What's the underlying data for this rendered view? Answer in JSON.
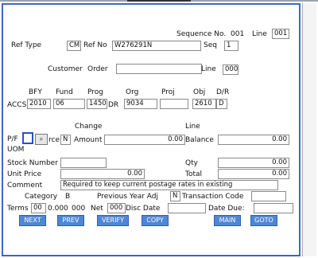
{
  "header": {
    "seq_label": "Sequence No.",
    "seq_value": "001",
    "line_label": "Line",
    "line_value": "001"
  },
  "ref": {
    "type_label": "Ref Type",
    "type_value": "CM",
    "no_label": "Ref No",
    "no_value": "W276291N",
    "seq_label": "Seq",
    "seq_value": "1"
  },
  "customer": {
    "label": "Customer",
    "order_label": "Order",
    "order_value": "",
    "line_label": "Line",
    "line_value": "000"
  },
  "accs": {
    "row_label": "ACCS",
    "bfy_label": "BFY",
    "bfy_value": "2010",
    "fund_label": "Fund",
    "fund_value": "06",
    "prog_label": "Prog",
    "prog_value": "1450",
    "prog_suffix": "DR",
    "org_label": "Org",
    "org_value": "9034",
    "proj_label": "Proj",
    "proj_value": "",
    "obj_label": "Obj",
    "obj_value": "2610",
    "dr_label": "D/R",
    "dr_value": "D"
  },
  "amounts": {
    "pf_label": "P/F",
    "pf_value": "",
    "pf_tail": "rce",
    "pf_flag": "N",
    "uom_label": "UOM",
    "change_label": "Change",
    "amount_label": "Amount",
    "amount_value": "0.00",
    "line_label": "Line",
    "balance_label": "Balance",
    "balance_value": "0.00"
  },
  "stock": {
    "label": "Stock Number",
    "value": "",
    "qty_label": "Qty",
    "qty_value": "0.00"
  },
  "price": {
    "label": "Unit Price",
    "value": "0.00",
    "total_label": "Total",
    "total_value": "0.00"
  },
  "comment": {
    "label": "Comment",
    "value": "Required to keep current postage rates in existing"
  },
  "category": {
    "label": "Category",
    "value": "B",
    "prev_label": "Previous Year Adj",
    "prev_value": "N",
    "tcode_label": "Transaction Code",
    "tcode_value": ""
  },
  "terms": {
    "label": "Terms",
    "v1": "00",
    "v2": "0.000",
    "v3": "000",
    "net_label": "Net",
    "net_value": "000",
    "disc_label": "Disc Date",
    "disc_value": "",
    "due_label": "Date Due:",
    "due_value": ""
  },
  "buttons": {
    "next": "NEXT",
    "prev": "PREV",
    "verify": "VERIFY",
    "copy": "COPY",
    "main": "MAIN",
    "goto": "GOTO"
  },
  "icons": {
    "lookup": "magnifier-icon"
  },
  "colors": {
    "border": "#3f67c5",
    "button": "#4f87d6"
  }
}
